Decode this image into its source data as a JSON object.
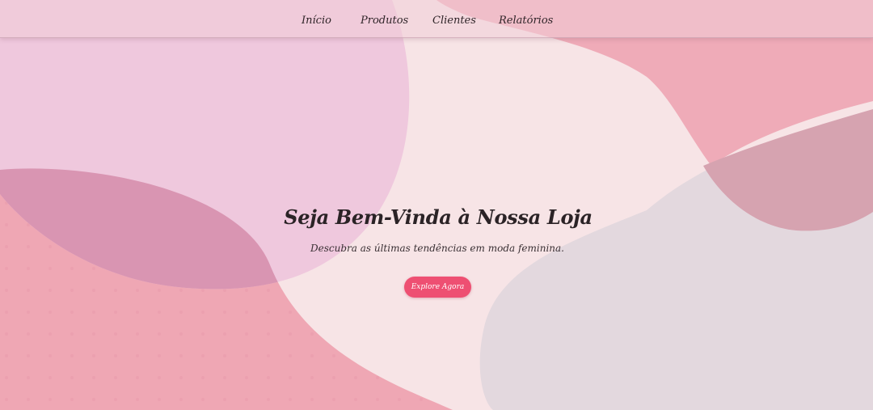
{
  "nav": {
    "items": [
      {
        "label": "Início"
      },
      {
        "label": "Produtos"
      },
      {
        "label": "Clientes"
      },
      {
        "label": "Relatórios"
      }
    ]
  },
  "hero": {
    "title": "Seja Bem-Vinda à Nossa Loja",
    "subtitle": "Descubra as últimas tendências em moda feminina.",
    "cta_label": "Explore Agora"
  },
  "colors": {
    "background": "#f7e4e6",
    "lilac_blob": "#efc6dc",
    "pink_blob": "#efa7b4",
    "mauve_overlap": "#d993b1",
    "grey_blob": "#e2d7de",
    "button": "#ee4f72",
    "text": "#2b2326"
  }
}
